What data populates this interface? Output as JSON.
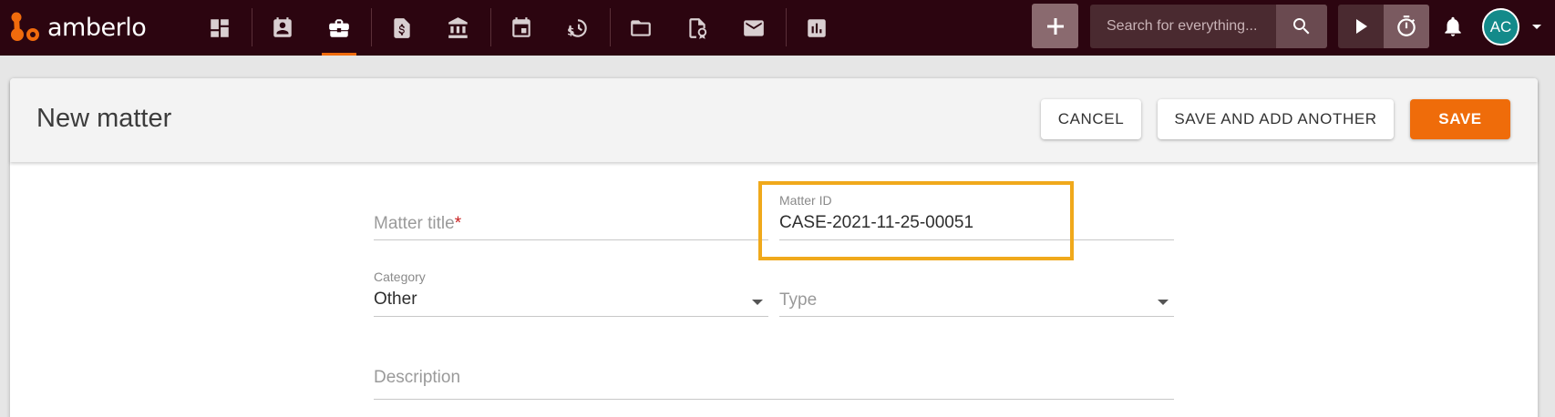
{
  "app": {
    "logo_text": "amberlo",
    "brand_color": "#f06b0d",
    "topbar_color": "#2c0510"
  },
  "nav": {
    "items": [
      {
        "name": "dashboard",
        "icon": "dashboard-icon"
      },
      {
        "name": "contacts",
        "icon": "contacts-icon"
      },
      {
        "name": "matters",
        "icon": "briefcase-icon",
        "active": true
      },
      {
        "name": "billing",
        "icon": "invoice-dollar-icon"
      },
      {
        "name": "banking",
        "icon": "bank-icon"
      },
      {
        "name": "calendar",
        "icon": "calendar-icon"
      },
      {
        "name": "time-money",
        "icon": "time-money-icon"
      },
      {
        "name": "documents",
        "icon": "folder-icon"
      },
      {
        "name": "templates",
        "icon": "certificate-document-icon"
      },
      {
        "name": "mail",
        "icon": "mail-icon"
      },
      {
        "name": "reports",
        "icon": "bar-chart-icon"
      }
    ]
  },
  "search": {
    "placeholder": "Search for everything..."
  },
  "user": {
    "initials": "AC",
    "avatar_color": "#138a8a"
  },
  "page": {
    "title": "New matter",
    "cancel_label": "CANCEL",
    "save_add_label": "SAVE AND ADD ANOTHER",
    "save_label": "SAVE",
    "save_color": "#ef6c0a"
  },
  "form": {
    "matter_title": {
      "placeholder": "Matter title",
      "required_mark": "*"
    },
    "matter_id": {
      "label": "Matter ID",
      "value": "CASE-2021-11-25-00051"
    },
    "category": {
      "label": "Category",
      "value": "Other"
    },
    "type": {
      "placeholder": "Type"
    },
    "description": {
      "placeholder": "Description"
    }
  },
  "highlight_color": "#f0a91b"
}
